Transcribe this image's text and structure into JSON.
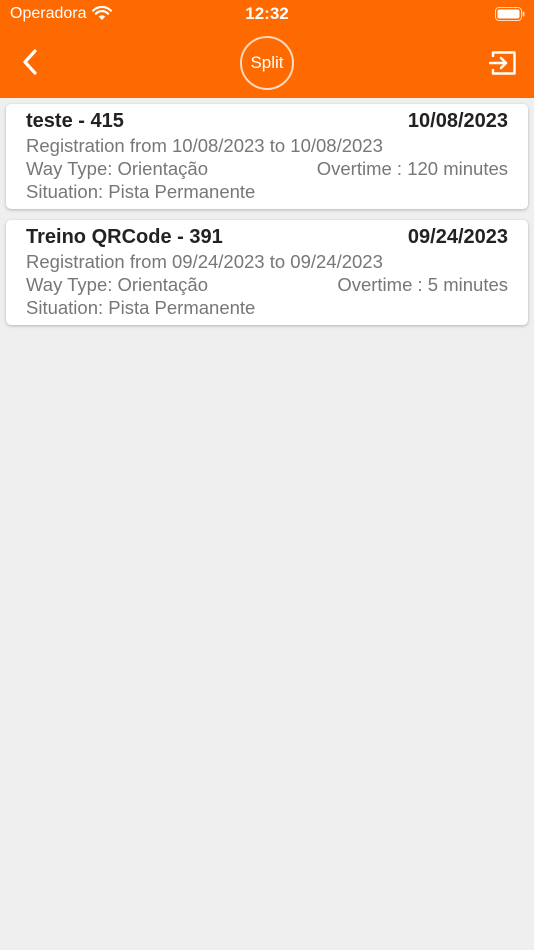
{
  "status_bar": {
    "carrier": "Operadora",
    "time": "12:32"
  },
  "header": {
    "logo_text": "Split",
    "back_icon": "chevron-left-icon",
    "logout_icon": "logout-icon"
  },
  "colors": {
    "header_bg": "#ff6a00",
    "page_bg": "#efefef"
  },
  "cards": [
    {
      "title": "teste - 415",
      "date": "10/08/2023",
      "registration": "Registration from 10/08/2023 to 10/08/2023",
      "way_type": "Way Type: Orientação",
      "overtime": "Overtime : 120 minutes",
      "situation": "Situation: Pista Permanente"
    },
    {
      "title": "Treino QRCode - 391",
      "date": "09/24/2023",
      "registration": "Registration from 09/24/2023 to 09/24/2023",
      "way_type": "Way Type: Orientação",
      "overtime": "Overtime : 5 minutes",
      "situation": "Situation: Pista Permanente"
    }
  ]
}
